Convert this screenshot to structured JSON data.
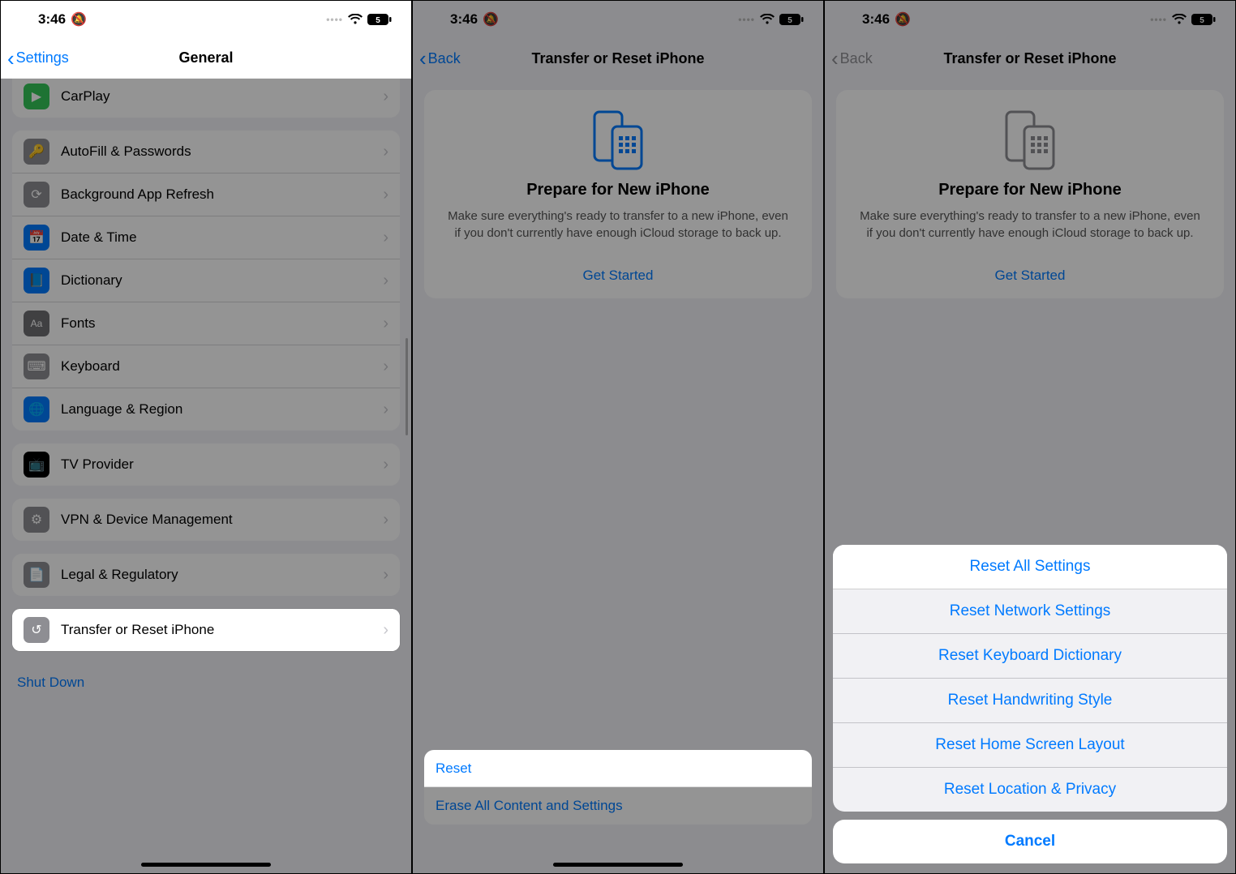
{
  "status": {
    "time": "3:46",
    "silent_icon": "🔕",
    "battery_label": "5"
  },
  "panel1": {
    "back_label": "Settings",
    "title": "General",
    "rows": {
      "carplay": "CarPlay",
      "autofill": "AutoFill & Passwords",
      "bgrefresh": "Background App Refresh",
      "datetime": "Date & Time",
      "dictionary": "Dictionary",
      "fonts": "Fonts",
      "keyboard": "Keyboard",
      "langregion": "Language & Region",
      "tvprovider": "TV Provider",
      "vpn": "VPN & Device Management",
      "legal": "Legal & Regulatory",
      "transfer": "Transfer or Reset iPhone",
      "shutdown": "Shut Down"
    }
  },
  "panel2": {
    "back_label": "Back",
    "title": "Transfer or Reset iPhone",
    "card_title": "Prepare for New iPhone",
    "card_body": "Make sure everything's ready to transfer to a new iPhone, even if you don't currently have enough iCloud storage to back up.",
    "card_cta": "Get Started",
    "reset": "Reset",
    "erase": "Erase All Content and Settings"
  },
  "panel3": {
    "back_label": "Back",
    "title": "Transfer or Reset iPhone",
    "card_title": "Prepare for New iPhone",
    "card_body": "Make sure everything's ready to transfer to a new iPhone, even if you don't currently have enough iCloud storage to back up.",
    "card_cta": "Get Started",
    "sheet": {
      "reset_all": "Reset All Settings",
      "reset_network": "Reset Network Settings",
      "reset_keyboard": "Reset Keyboard Dictionary",
      "reset_handwriting": "Reset Handwriting Style",
      "reset_home": "Reset Home Screen Layout",
      "reset_location": "Reset Location & Privacy",
      "cancel": "Cancel"
    }
  }
}
